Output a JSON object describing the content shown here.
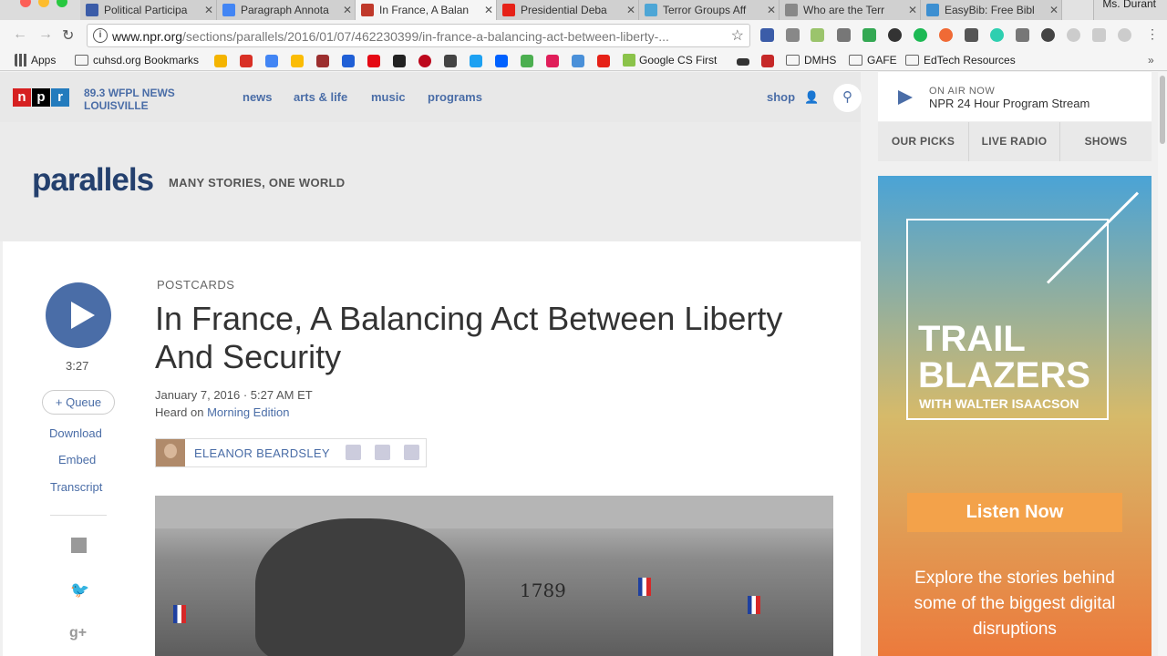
{
  "browser": {
    "tabs": [
      {
        "title": "Political Participa",
        "favicon_color": "#3b5ca8"
      },
      {
        "title": "Paragraph Annota",
        "favicon_color": "#4285f4"
      },
      {
        "title": "In France, A Balan",
        "favicon_color": "#c0392b",
        "active": true
      },
      {
        "title": "Presidential Deba",
        "favicon_color": "#e62117"
      },
      {
        "title": "Terror Groups Aff",
        "favicon_color": "#4da6d6"
      },
      {
        "title": "Who are the Terr",
        "favicon_color": "#888888"
      },
      {
        "title": "EasyBib: Free Bibl",
        "favicon_color": "#3d8fd1"
      }
    ],
    "tab_close": "✕",
    "user_name": "Ms. Durant",
    "url_host": "www.npr.org",
    "url_path": "/sections/parallels/2016/01/07/462230399/in-france-a-balancing-act-between-liberty-...",
    "bookmarks": {
      "apps": "Apps",
      "cuhsd": "cuhsd.org Bookmarks",
      "google_cs": "Google CS First",
      "dmhs": "DMHS",
      "gafe": "GAFE",
      "edtech": "EdTech Resources"
    }
  },
  "npr": {
    "logo_letters": [
      "n",
      "p",
      "r"
    ],
    "logo_colors": [
      "#d62021",
      "#000000",
      "#237bbd"
    ],
    "station_line1": "89.3 WFPL NEWS",
    "station_line2": "LOUISVILLE",
    "nav": [
      "news",
      "arts & life",
      "music",
      "programs"
    ],
    "shop": "shop"
  },
  "section": {
    "name": "parallels",
    "tagline": "MANY STORIES, ONE WORLD"
  },
  "article": {
    "kicker": "POSTCARDS",
    "headline": "In France, A Balancing Act Between Liberty And Security",
    "date": "January 7, 2016 · 5:27 AM ET",
    "heard_on_prefix": "Heard on ",
    "heard_on_show": "Morning Edition",
    "author": "ELEANOR BEARDSLEY",
    "duration": "3:27",
    "queue": "+ Queue",
    "download": "Download",
    "embed": "Embed",
    "transcript": "Transcript"
  },
  "sidebar": {
    "on_air_label": "ON AIR NOW",
    "on_air_stream": "NPR 24 Hour Program Stream",
    "tabs": [
      "OUR PICKS",
      "LIVE RADIO",
      "SHOWS"
    ],
    "ad_title": "TRAIL BLAZERS",
    "ad_subtitle": "WITH WALTER ISAACSON",
    "ad_button": "Listen Now",
    "ad_blurb": "Explore the stories behind some of the biggest digital disruptions"
  },
  "photo_text": "1789"
}
